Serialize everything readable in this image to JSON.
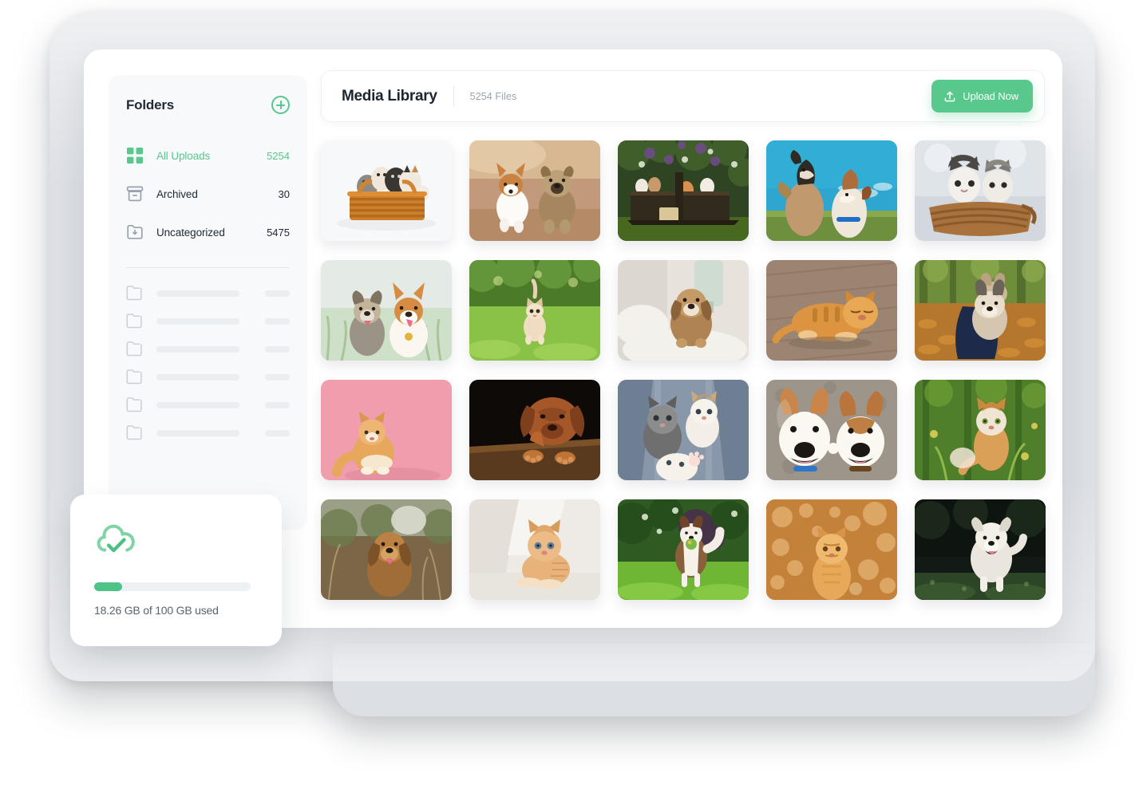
{
  "sidebar": {
    "title": "Folders",
    "add_icon": "circle-plus-icon",
    "accent": "#58c88c",
    "items": [
      {
        "label": "All Uploads",
        "count": "5254",
        "icon": "grid-icon",
        "active": true
      },
      {
        "label": "Archived",
        "count": "30",
        "icon": "archive-box-icon",
        "active": false
      },
      {
        "label": "Uncategorized",
        "count": "5475",
        "icon": "folder-download-icon",
        "active": false
      }
    ],
    "skeleton_rows": 6,
    "skeleton_icon": "folder-outline-icon"
  },
  "header": {
    "title": "Media Library",
    "file_count": "5254 Files",
    "upload_label": "Upload Now",
    "upload_icon": "upload-icon",
    "upload_color": "#58c88c"
  },
  "storage_card": {
    "icon": "cloud-check-icon",
    "icon_color": "#7fd3a5",
    "bar_color": "#4ec287",
    "bar_percent": 18,
    "label": "18.26 GB of 100 GB used"
  },
  "media_grid": {
    "columns": 5,
    "rows": 4,
    "items": [
      {
        "name": "kittens-in-wicker-basket",
        "alt": "Five kittens in an orange wicker basket on white",
        "bg": "#f6f7f8"
      },
      {
        "name": "corgi-and-terrier-running",
        "alt": "Corgi and terrier running on dirt path",
        "bg": "#c8a184"
      },
      {
        "name": "kittens-in-garden-crate",
        "alt": "Kittens in dark wooden crate under lilac bush",
        "bg": "#3f5430"
      },
      {
        "name": "two-dogs-howling-blue-sky",
        "alt": "Shepherd and spaniel howling against blue sky",
        "bg": "#2fa6cf"
      },
      {
        "name": "two-kittens-in-basket",
        "alt": "Two grey-white kittens in basket, pale backdrop",
        "bg": "#cfd6dc"
      },
      {
        "name": "terrier-and-corgi-in-grass",
        "alt": "Terrier and corgi sitting in tall grass",
        "bg": "#e6ecea"
      },
      {
        "name": "kitten-running-in-grass",
        "alt": "Ginger kitten running through sunny green grass",
        "bg": "#6ea83a"
      },
      {
        "name": "cockapoo-puppy-on-bed",
        "alt": "Brown cockapoo puppy on white bed",
        "bg": "#e8e6e0"
      },
      {
        "name": "orange-cat-on-wood-floor",
        "alt": "Orange tabby cat lying on wooden floor",
        "bg": "#9c8a78"
      },
      {
        "name": "husky-puppy-in-autumn-leaves",
        "alt": "Husky puppy hugged in navy coat among leaves",
        "bg": "#b0742f"
      },
      {
        "name": "ginger-cat-pink-background",
        "alt": "Fluffy ginger cat on pink studio background",
        "bg": "#f09dae"
      },
      {
        "name": "mastiff-puppy-dark-background",
        "alt": "Bordeaux mastiff puppy on dark background",
        "bg": "#120d0a"
      },
      {
        "name": "kittens-on-denim",
        "alt": "Three kittens cuddled on denim jeans",
        "bg": "#7d8a9b"
      },
      {
        "name": "two-corgis-smiling",
        "alt": "Two corgis smiling up at camera on pavement",
        "bg": "#a39c92"
      },
      {
        "name": "tabby-cat-in-meadow",
        "alt": "Ginger-white tabby cat sitting in green meadow",
        "bg": "#5f8f34"
      },
      {
        "name": "golden-dog-in-field",
        "alt": "Golden retriever puppy in blurred field",
        "bg": "#7c6a4c"
      },
      {
        "name": "ginger-kitten-on-white-sofa",
        "alt": "Ginger kitten lying on white sofa",
        "bg": "#ece8e3"
      },
      {
        "name": "border-collie-with-ball",
        "alt": "Border collie carrying ball on green lawn",
        "bg": "#3f6b2a"
      },
      {
        "name": "cat-with-bokeh-lights",
        "alt": "Ginger cat with warm orange bokeh lights",
        "bg": "#c07c35"
      },
      {
        "name": "white-puppy-running-at-night",
        "alt": "White fluffy puppy running on grass at dusk",
        "bg": "#17201a"
      }
    ]
  }
}
